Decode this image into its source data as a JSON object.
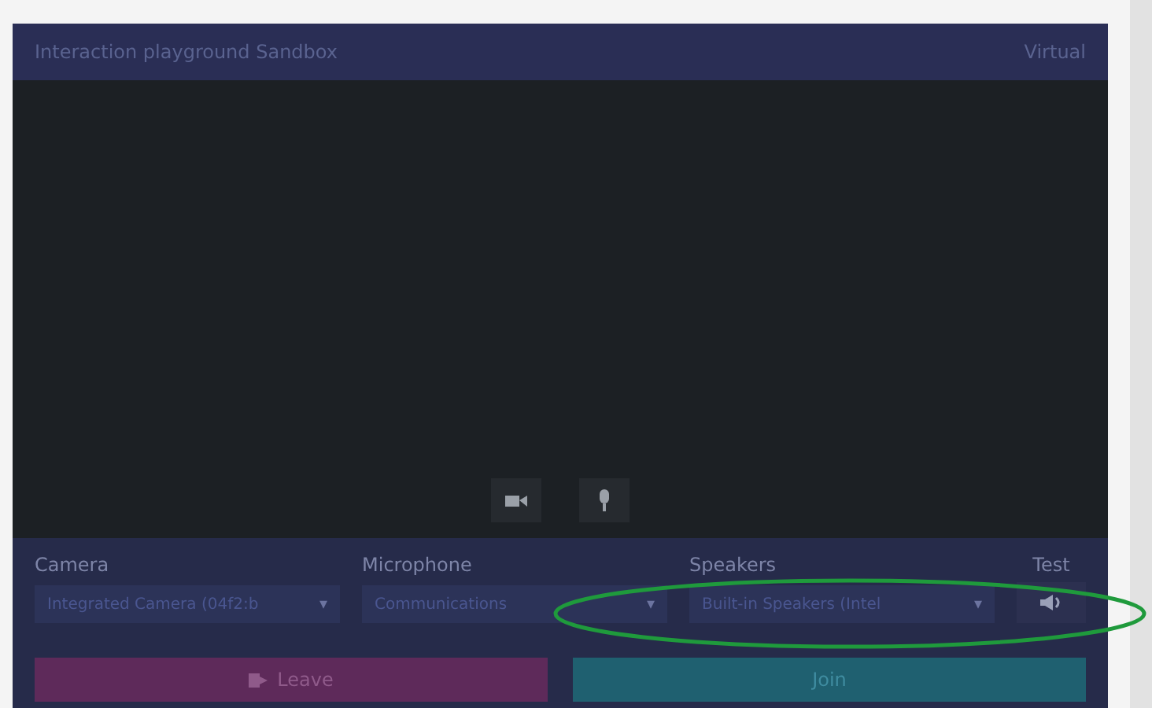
{
  "window": {
    "title": "Interaction playground Sandbox",
    "badge": "Virtual"
  },
  "media_buttons": [
    {
      "kind": "camera",
      "on": false
    },
    {
      "kind": "microphone",
      "on": false
    }
  ],
  "devices": [
    {
      "label": "Camera",
      "value": "Integrated Camera (04f2:b",
      "caret": "▾"
    },
    {
      "label": "Microphone",
      "value": "Communications",
      "caret": "▾"
    },
    {
      "label": "Speakers",
      "value": "Built-in Speakers (Intel",
      "caret": "▾"
    }
  ],
  "test": {
    "label": "Test"
  },
  "actions": [
    {
      "kind": "leave",
      "label": "Leave"
    },
    {
      "kind": "join",
      "label": "Join"
    }
  ],
  "highlight": {
    "color": "#1f9a3c"
  }
}
